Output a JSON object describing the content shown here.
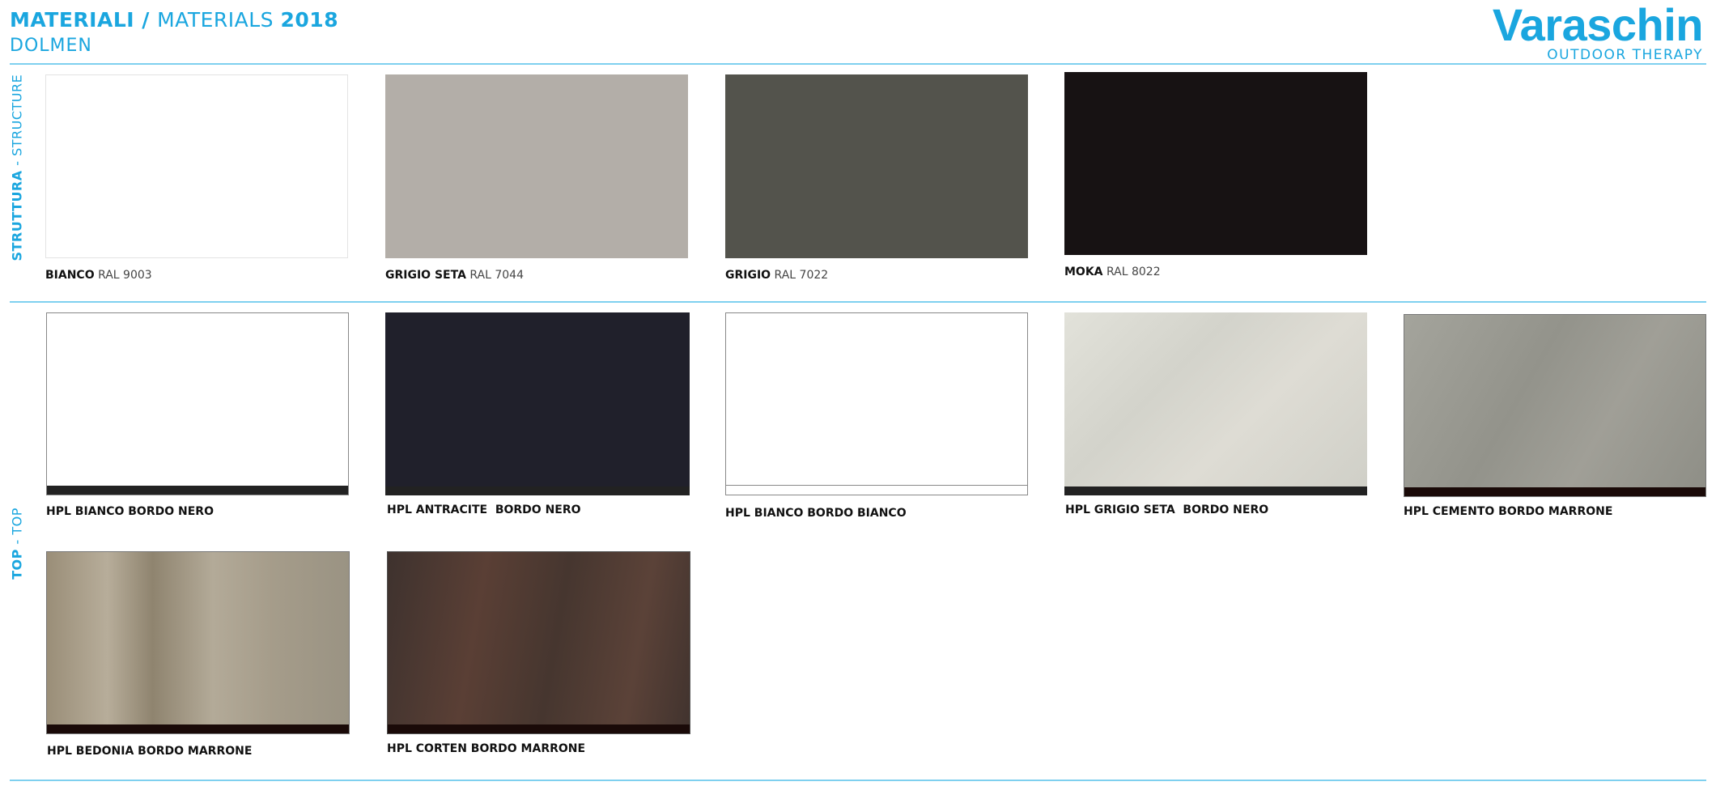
{
  "header": {
    "title_it": "MATERIALI",
    "title_sep": " / ",
    "title_en": "MATERIALS",
    "year": "2018",
    "product": "DOLMEN"
  },
  "brand": {
    "name": "Varaschin",
    "tagline": "OUTDOOR THERAPY",
    "color": "#1aa6df"
  },
  "sections": {
    "structure": {
      "label_it": "STRUTTURA",
      "sep": " - ",
      "label_en": "STRUCTURE"
    },
    "top": {
      "label_it": "TOP",
      "sep": " - ",
      "label_en": "TOP"
    }
  },
  "structure_swatches": [
    {
      "name": "BIANCO",
      "code": "RAL 9003",
      "color": "#ffffff"
    },
    {
      "name": "GRIGIO SETA",
      "code": "RAL 7044",
      "color": "#b3aea8"
    },
    {
      "name": "GRIGIO",
      "code": "RAL 7022",
      "color": "#53534c"
    },
    {
      "name": "MOKA",
      "code": "RAL 8022",
      "color": "#171213"
    }
  ],
  "top_swatches": [
    {
      "name": "HPL BIANCO BORDO NERO",
      "color": "#ffffff",
      "edge_color": "#222222"
    },
    {
      "name": "HPL ANTRACITE  BORDO NERO",
      "color": "#20202b",
      "edge_color": "#222222"
    },
    {
      "name": "HPL BIANCO BORDO BIANCO",
      "color": "#ffffff",
      "edge_color": "#ffffff"
    },
    {
      "name": "HPL GRIGIO SETA  BORDO NERO",
      "color": "#dcdcd4",
      "edge_color": "#222222"
    },
    {
      "name": "HPL CEMENTO BORDO MARRONE",
      "color": "#9a9a92",
      "edge_color": "#1a0a08"
    },
    {
      "name": "HPL BEDONIA BORDO MARRONE",
      "color": "#a49a86",
      "edge_color": "#1a0a08"
    },
    {
      "name": "HPL CORTEN BORDO MARRONE",
      "color": "#4e3c36",
      "edge_color": "#1a0a08"
    }
  ]
}
